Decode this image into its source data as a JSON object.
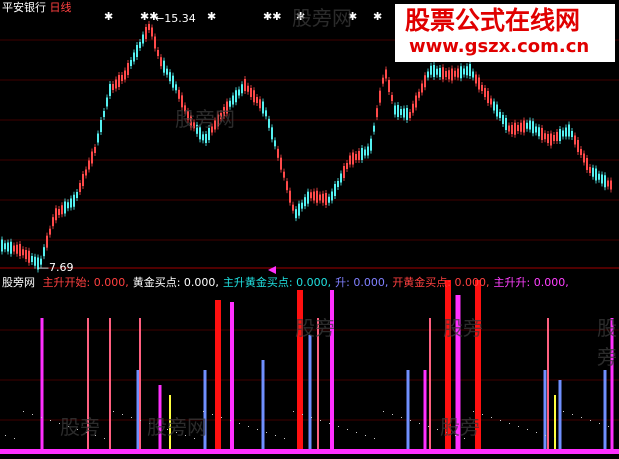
{
  "main_panel": {
    "stock_name": "平安银行",
    "period": "日线",
    "high_label": "15.34",
    "low_label": "7.69"
  },
  "banner": {
    "title": "股票公式在线网",
    "url": "www.gszx.com.cn"
  },
  "watermarks": [
    "股旁网",
    "股旁网",
    "股旁",
    "股旁",
    "股旁",
    "股旁网",
    "股旁",
    "股旁"
  ],
  "indicator_panel": {
    "name": "股旁网",
    "items": [
      {
        "label": "主升开始:",
        "value": "0.000",
        "color": "#ff4040"
      },
      {
        "label": "黄金买点:",
        "value": "0.000",
        "color": "#ffffff"
      },
      {
        "label": "主升黄金买点:",
        "value": "0.000",
        "color": "#20e0e0"
      },
      {
        "label": "升:",
        "value": "0.000",
        "color": "#8080ff"
      },
      {
        "label": "开黄金买点:",
        "value": "0.000",
        "color": "#ff4040"
      },
      {
        "label": "主升升:",
        "value": "0.000",
        "color": "#ff40ff"
      }
    ]
  },
  "colors": {
    "up_candle": "#ff4a4a",
    "down_candle": "#54f0f0",
    "magenta": "#ff30ff",
    "pink": "#ff6080",
    "blue": "#7090ff",
    "red": "#ff1010",
    "yellow": "#ffff40",
    "grid": "#800000"
  }
}
